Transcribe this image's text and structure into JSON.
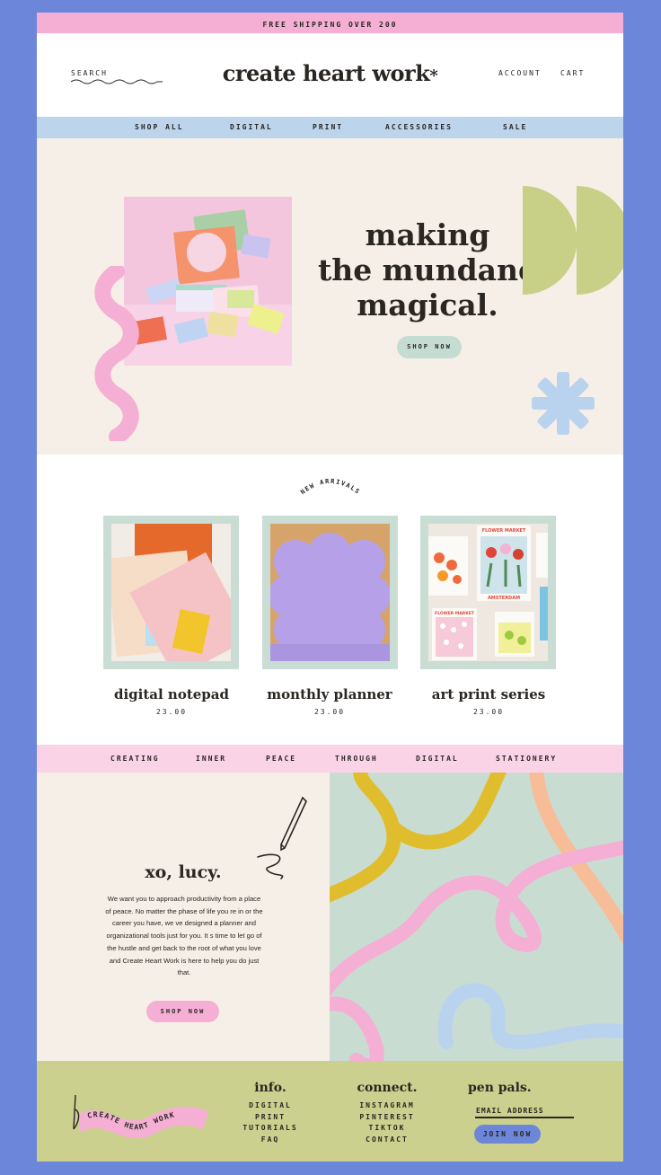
{
  "promo": {
    "text": "FREE SHIPPING OVER  200"
  },
  "header": {
    "search_label": "SEARCH",
    "logo": "create heart work",
    "logo_mark": "*",
    "account_label": "ACCOUNT",
    "cart_label": "CART"
  },
  "nav": {
    "items": [
      {
        "label": "SHOP  ALL"
      },
      {
        "label": "DIGITAL"
      },
      {
        "label": "PRINT"
      },
      {
        "label": "ACCESSORIES"
      },
      {
        "label": "SALE"
      }
    ]
  },
  "hero": {
    "title_line1": "making",
    "title_line2": "the mundane",
    "title_line3": "magical.",
    "cta": "SHOP NOW"
  },
  "arrivals": {
    "heading": "NEW ARRIVALS",
    "products": [
      {
        "name": "digital notepad",
        "price": "23.00"
      },
      {
        "name": "monthly planner",
        "price": "23.00"
      },
      {
        "name": "art print series",
        "price": "23.00"
      }
    ],
    "print_labels": [
      "FLOWER MARKET",
      "AMSTERDAM",
      "FLOWER MARKET"
    ]
  },
  "ticker": {
    "words": [
      "CREATING",
      "INNER",
      "PEACE",
      "THROUGH",
      "DIGITAL",
      "STATIONERY"
    ]
  },
  "story": {
    "title": "xo, lucy.",
    "body": "We want you to approach productivity from a place of peace. No matter the phase of life you re in or the career you have, we ve designed a planner and organizational tools just for you. It s time to let go of the hustle and get back to the root of what you love and Create Heart Work is here to help you do just that.",
    "cta": "SHOP NOW"
  },
  "footer": {
    "badge_text": "CREATE HEART WORK",
    "info": {
      "heading": "info.",
      "links": [
        "DIGITAL",
        "PRINT",
        "TUTORIALS",
        "FAQ"
      ]
    },
    "connect": {
      "heading": "connect.",
      "links": [
        "INSTAGRAM",
        "PINTEREST",
        "TIKTOK",
        "CONTACT"
      ]
    },
    "penpals": {
      "heading": "pen pals.",
      "email_label": "EMAIL ADDRESS",
      "cta": "JOIN NOW"
    }
  },
  "colors": {
    "frame": "#6c87d9",
    "pink": "#f5afd4",
    "nav_blue": "#bcd5ec",
    "cream": "#f6efe7",
    "sage": "#c9ddd4",
    "olive": "#cbd08e",
    "mustard": "#e0bd2c",
    "peach": "#f7bd98",
    "sky": "#b9d3ef",
    "green_shape": "#c8d087"
  }
}
